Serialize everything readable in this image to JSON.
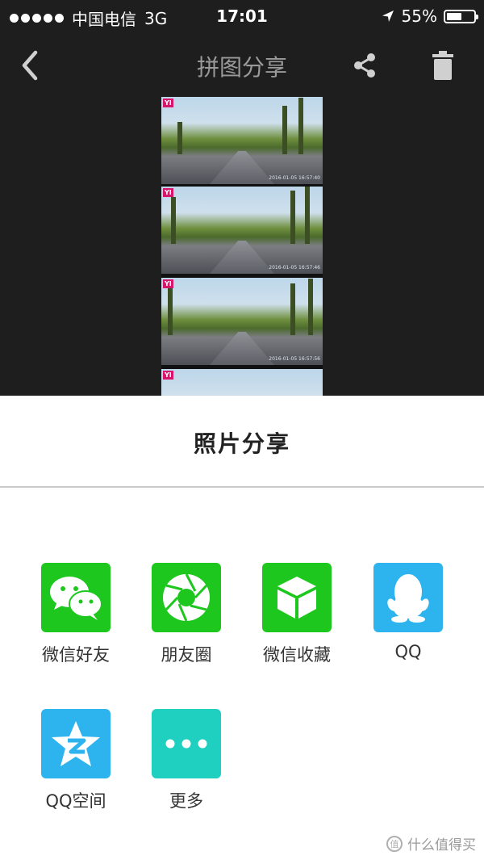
{
  "status_bar": {
    "carrier": "中国电信",
    "network": "3G",
    "time": "17:01",
    "battery_text": "55%",
    "battery_level": 0.55
  },
  "nav": {
    "title": "拼图分享",
    "back_icon": "chevron-left-icon",
    "share_icon": "share-icon",
    "delete_icon": "trash-icon"
  },
  "preview": {
    "logo_text": "YI",
    "frames": 4
  },
  "sheet": {
    "title": "照片分享",
    "items": [
      {
        "label": "微信好友",
        "icon": "wechat-icon",
        "color": "#1ec71e"
      },
      {
        "label": "朋友圈",
        "icon": "moments-icon",
        "color": "#1ec71e"
      },
      {
        "label": "微信收藏",
        "icon": "wechat-favorites-icon",
        "color": "#1ec71e"
      },
      {
        "label": "QQ",
        "icon": "qq-icon",
        "color": "#2db4ef"
      },
      {
        "label": "QQ空间",
        "icon": "qzone-icon",
        "color": "#2db4ef"
      },
      {
        "label": "更多",
        "icon": "more-icon",
        "color": "#1fd0c0"
      }
    ]
  },
  "watermark": {
    "text": "什么值得买",
    "badge": "值"
  }
}
